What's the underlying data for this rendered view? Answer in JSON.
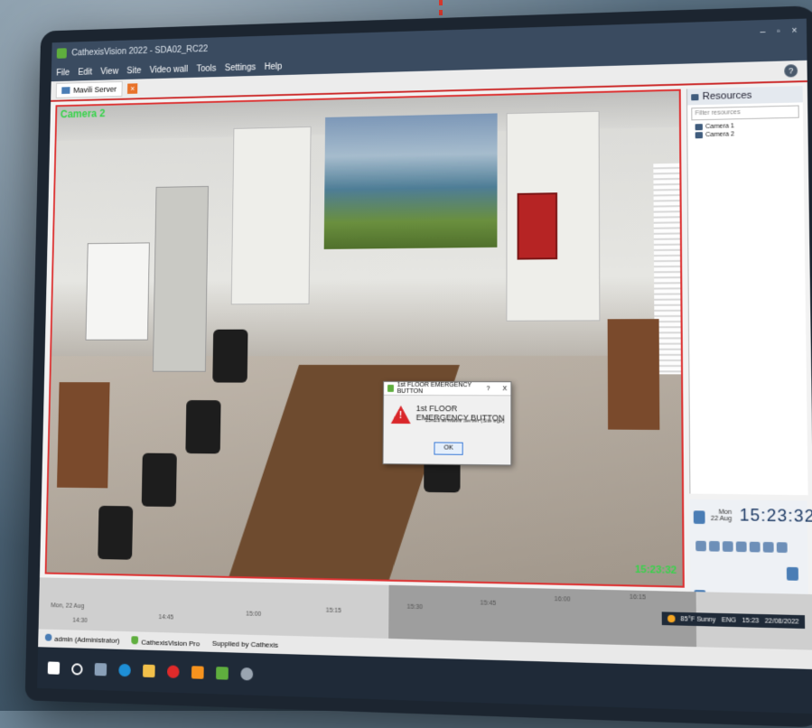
{
  "window": {
    "title": "CathexisVision 2022 - SDA02_RC22",
    "min_glyph": "–",
    "max_glyph": "▫",
    "close_glyph": "×"
  },
  "menu": [
    "File",
    "Edit",
    "View",
    "Site",
    "Video wall",
    "Tools",
    "Settings",
    "Help"
  ],
  "tab": {
    "label": "Mavili Server",
    "close_glyph": "×"
  },
  "help_glyph": "?",
  "video": {
    "camera_label": "Camera 2",
    "timestamp": "15:23:32",
    "border_color": "#d33333",
    "overlay_color": "#37d34a"
  },
  "dialog": {
    "title": "1st FLOOR EMERGENCY BUTTON",
    "question_glyph": "?",
    "close_glyph": "X",
    "heading": "1st FLOOR EMERGENCY BUTTON",
    "message": "15h23 at Mavili Server (Site ege)",
    "warning_glyph": "!",
    "ok_label": "OK"
  },
  "resources": {
    "title": "Resources",
    "filter_placeholder": "Filter resources",
    "items": [
      "Camera 1",
      "Camera 2"
    ]
  },
  "playback": {
    "day": "Mon",
    "date": "22 Aug",
    "time": "15:23:32"
  },
  "timeline": {
    "date_label": "Mon, 22 Aug",
    "ticks": [
      "14:30",
      "14:45",
      "15:00",
      "15:15",
      "15:30",
      "15:45",
      "16:00",
      "16:15"
    ]
  },
  "status": {
    "user": "admin (Administrator)",
    "product": "CathexisVision Pro",
    "supplier": "Supplied by Cathexis"
  },
  "tray": {
    "weather": "85°F Sunny",
    "lang": "ENG",
    "clock": "15:23",
    "date": "22/08/2022"
  },
  "colors": {
    "accent": "#3a4b60",
    "alarm": "#d9262a",
    "brand": "#5fae3e"
  }
}
